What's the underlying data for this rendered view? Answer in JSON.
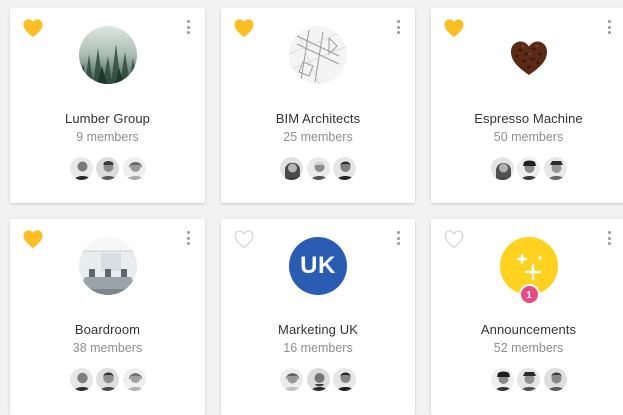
{
  "colors": {
    "favorite": "#fbbf24",
    "not_favorite_stroke": "#d4d4d4",
    "uk_blue": "#2b5cb3",
    "announce_yellow": "#ffd21f",
    "badge_pink": "#e94b83"
  },
  "groups": [
    {
      "name": "Lumber Group",
      "members": "9 members",
      "favorite": true,
      "image": "forest-photo"
    },
    {
      "name": "BIM Architects",
      "members": "25 members",
      "favorite": true,
      "image": "blueprint-photo"
    },
    {
      "name": "Espresso Machine",
      "members": "50 members",
      "favorite": true,
      "image": "coffee-heart-photo"
    },
    {
      "name": "Boardroom",
      "members": "38 members",
      "favorite": true,
      "image": "office-photo"
    },
    {
      "name": "Marketing UK",
      "members": "16 members",
      "favorite": false,
      "image": "text-avatar",
      "initials": "UK"
    },
    {
      "name": "Announcements",
      "members": "52 members",
      "favorite": false,
      "image": "announcement-icon",
      "badge": "1"
    }
  ]
}
